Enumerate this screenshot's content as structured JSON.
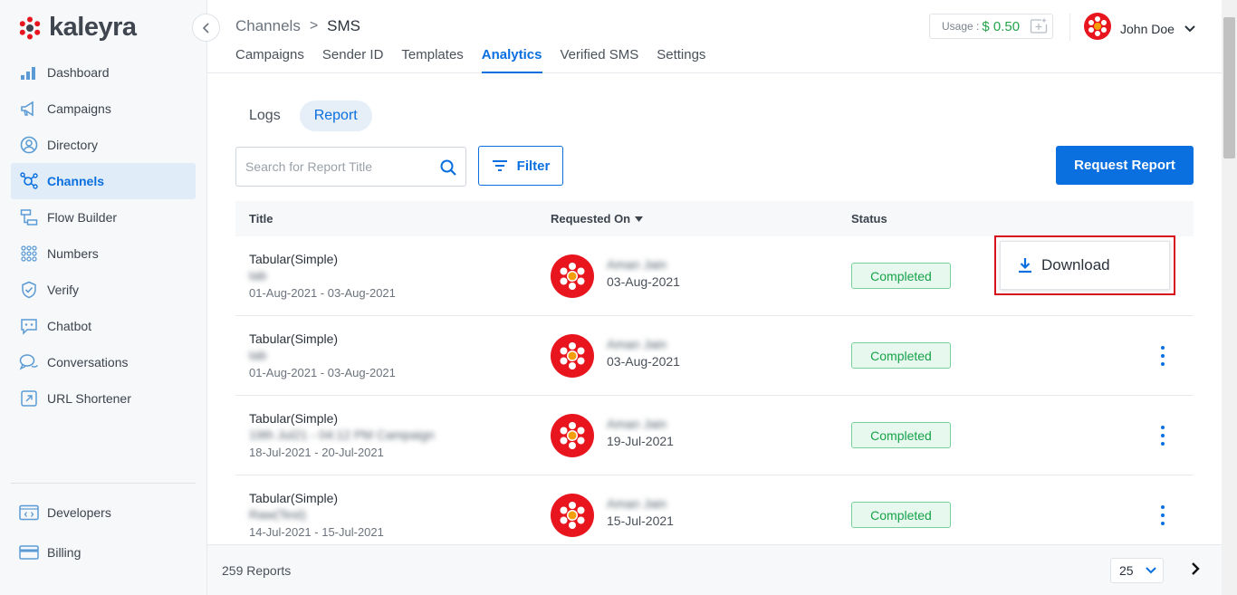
{
  "brand": {
    "name": "kaleyra"
  },
  "sidebar": {
    "items": [
      {
        "label": "Dashboard",
        "icon": "dashboard-icon"
      },
      {
        "label": "Campaigns",
        "icon": "megaphone-icon"
      },
      {
        "label": "Directory",
        "icon": "user-circle-icon"
      },
      {
        "label": "Channels",
        "icon": "channels-icon",
        "active": true
      },
      {
        "label": "Flow Builder",
        "icon": "flow-icon"
      },
      {
        "label": "Numbers",
        "icon": "grid-dots-icon"
      },
      {
        "label": "Verify",
        "icon": "shield-check-icon"
      },
      {
        "label": "Chatbot",
        "icon": "chatbot-icon"
      },
      {
        "label": "Conversations",
        "icon": "chat-bubbles-icon"
      },
      {
        "label": "URL Shortener",
        "icon": "link-icon"
      }
    ],
    "bottom": [
      {
        "label": "Developers",
        "icon": "code-icon"
      },
      {
        "label": "Billing",
        "icon": "card-icon"
      }
    ]
  },
  "header": {
    "breadcrumb_parent": "Channels",
    "breadcrumb_sep": ">",
    "breadcrumb_current": "SMS",
    "tabs": [
      "Campaigns",
      "Sender ID",
      "Templates",
      "Analytics",
      "Verified SMS",
      "Settings"
    ],
    "active_tab": "Analytics",
    "usage_label": "Usage :",
    "usage_amount": "$ 0.50",
    "user_name": "John Doe"
  },
  "subtabs": {
    "logs": "Logs",
    "report": "Report",
    "active": "Report"
  },
  "search": {
    "placeholder": "Search for Report Title"
  },
  "filter_label": "Filter",
  "request_report_label": "Request Report",
  "table": {
    "headers": {
      "title": "Title",
      "requested_on": "Requested On",
      "status": "Status"
    },
    "rows": [
      {
        "type": "Tabular(Simple)",
        "name": "tab",
        "range": "01-Aug-2021 - 03-Aug-2021",
        "requester": "Aman Jain",
        "date": "03-Aug-2021",
        "status": "Completed"
      },
      {
        "type": "Tabular(Simple)",
        "name": "tab",
        "range": "01-Aug-2021 - 03-Aug-2021",
        "requester": "Aman Jain",
        "date": "03-Aug-2021",
        "status": "Completed"
      },
      {
        "type": "Tabular(Simple)",
        "name": "19th Jul21 - 04:12 PM Campaign",
        "range": "18-Jul-2021 - 20-Jul-2021",
        "requester": "Aman Jain",
        "date": "19-Jul-2021",
        "status": "Completed"
      },
      {
        "type": "Tabular(Simple)",
        "name": "Raw(Test)",
        "range": "14-Jul-2021 - 15-Jul-2021",
        "requester": "Aman Jain",
        "date": "15-Jul-2021",
        "status": "Completed"
      }
    ]
  },
  "download_menu": {
    "label": "Download"
  },
  "footer": {
    "count": "259 Reports",
    "per_page": "25"
  },
  "colors": {
    "primary": "#0a6fdf",
    "success": "#16a34a",
    "brand_red": "#e8141e",
    "highlight": "#d8101b"
  }
}
